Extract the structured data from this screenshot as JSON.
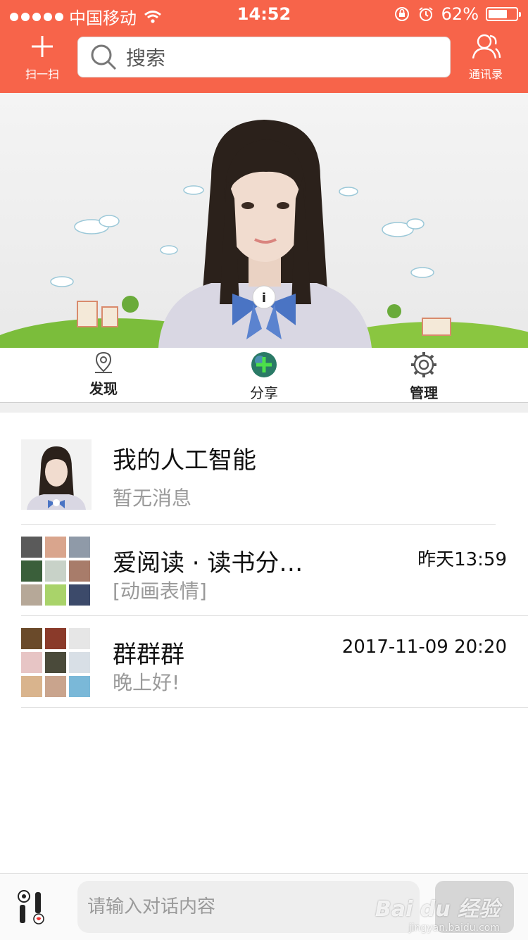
{
  "status_bar": {
    "carrier": "中国移动",
    "time": "14:52",
    "battery_text": "62%",
    "battery_level": 0.62
  },
  "nav": {
    "scan_label": "扫一扫",
    "search_placeholder": "搜索",
    "contacts_label": "通讯录"
  },
  "quick_tabs": [
    {
      "label": "发现",
      "icon": "location-pin-icon"
    },
    {
      "label": "分享",
      "icon": "share-globe-icon"
    },
    {
      "label": "管理",
      "icon": "gear-icon"
    }
  ],
  "chats": [
    {
      "name": "我的人工智能",
      "message": "暂无消息",
      "time": ""
    },
    {
      "name": "爱阅读 · 读书分…",
      "message": "[动画表情]",
      "time": "昨天13:59"
    },
    {
      "name": "群群群",
      "message": "晚上好!",
      "time": "2017-11-09 20:20"
    }
  ],
  "input_bar": {
    "placeholder": "请输入对话内容",
    "send_label": ""
  },
  "watermark": {
    "brand": "Bai du 经验",
    "url": "jingyan.baidu.com"
  },
  "colors": {
    "header": "#f7644a",
    "list_divider": "#dcdcdc",
    "secondary_text": "#9a9a9a"
  }
}
